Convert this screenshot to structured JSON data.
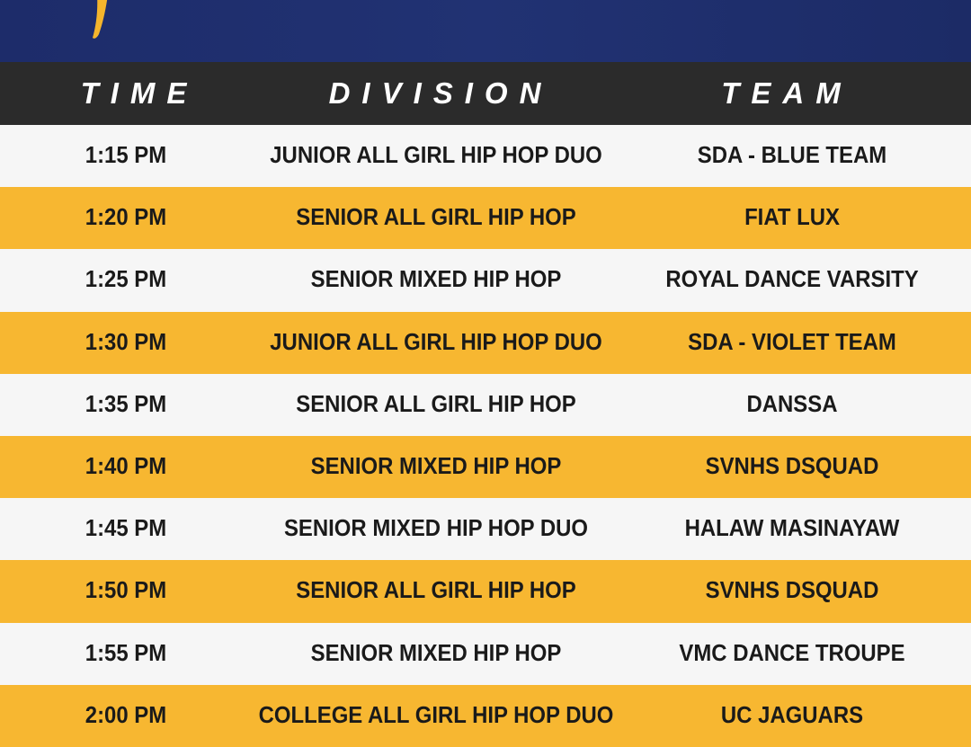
{
  "header": {
    "time": "TIME",
    "division": "DIVISION",
    "team": "TEAM"
  },
  "colors": {
    "navy": "#1f2f6e",
    "header_bg": "#2b2b2b",
    "gold": "#f7b731",
    "white_row": "#f6f6f6"
  },
  "rows": [
    {
      "time": "1:15 PM",
      "division": "JUNIOR ALL GIRL HIP HOP DUO",
      "team": "SDA - BLUE TEAM"
    },
    {
      "time": "1:20 PM",
      "division": "SENIOR ALL GIRL HIP HOP",
      "team": "FIAT LUX"
    },
    {
      "time": "1:25 PM",
      "division": "SENIOR MIXED HIP HOP",
      "team": "ROYAL DANCE VARSITY"
    },
    {
      "time": "1:30 PM",
      "division": "JUNIOR ALL GIRL HIP HOP DUO",
      "team": "SDA - VIOLET TEAM"
    },
    {
      "time": "1:35 PM",
      "division": "SENIOR ALL GIRL HIP HOP",
      "team": "DANSSA"
    },
    {
      "time": "1:40 PM",
      "division": "SENIOR MIXED HIP HOP",
      "team": "SVNHS DSQUAD"
    },
    {
      "time": "1:45 PM",
      "division": "SENIOR MIXED HIP HOP DUO",
      "team": "HALAW MASINAYAW"
    },
    {
      "time": "1:50 PM",
      "division": "SENIOR ALL GIRL HIP HOP",
      "team": "SVNHS DSQUAD"
    },
    {
      "time": "1:55 PM",
      "division": "SENIOR MIXED HIP HOP",
      "team": "VMC DANCE TROUPE"
    },
    {
      "time": "2:00 PM",
      "division": "COLLEGE ALL GIRL HIP HOP DUO",
      "team": "UC JAGUARS"
    }
  ]
}
